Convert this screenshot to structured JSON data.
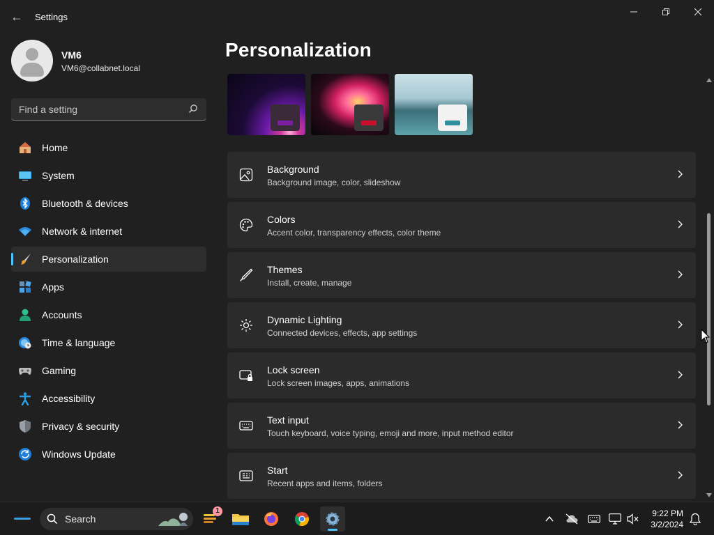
{
  "window": {
    "title": "Settings"
  },
  "user": {
    "name": "VM6",
    "email": "VM6@collabnet.local"
  },
  "search": {
    "placeholder": "Find a setting"
  },
  "sidebar": {
    "items": [
      {
        "label": "Home",
        "icon": "home-icon"
      },
      {
        "label": "System",
        "icon": "system-icon"
      },
      {
        "label": "Bluetooth & devices",
        "icon": "bluetooth-icon"
      },
      {
        "label": "Network & internet",
        "icon": "wifi-icon"
      },
      {
        "label": "Personalization",
        "icon": "brush-icon",
        "active": true
      },
      {
        "label": "Apps",
        "icon": "apps-icon"
      },
      {
        "label": "Accounts",
        "icon": "accounts-icon"
      },
      {
        "label": "Time & language",
        "icon": "globe-clock-icon"
      },
      {
        "label": "Gaming",
        "icon": "gamepad-icon"
      },
      {
        "label": "Accessibility",
        "icon": "accessibility-icon"
      },
      {
        "label": "Privacy & security",
        "icon": "shield-icon"
      },
      {
        "label": "Windows Update",
        "icon": "update-icon"
      }
    ]
  },
  "main": {
    "title": "Personalization",
    "themes": [
      {
        "name": "windows-bloom-dark",
        "accent": "#7a1fa2"
      },
      {
        "name": "glow-flower",
        "accent": "#c8102e"
      },
      {
        "name": "lake",
        "accent": "#2f8f9a"
      }
    ],
    "cards": [
      {
        "title": "Background",
        "subtitle": "Background image, color, slideshow",
        "icon": "image-icon"
      },
      {
        "title": "Colors",
        "subtitle": "Accent color, transparency effects, color theme",
        "icon": "palette-icon"
      },
      {
        "title": "Themes",
        "subtitle": "Install, create, manage",
        "icon": "pen-icon"
      },
      {
        "title": "Dynamic Lighting",
        "subtitle": "Connected devices, effects, app settings",
        "icon": "lighting-icon"
      },
      {
        "title": "Lock screen",
        "subtitle": "Lock screen images, apps, animations",
        "icon": "lock-screen-icon"
      },
      {
        "title": "Text input",
        "subtitle": "Touch keyboard, voice typing, emoji and more, input method editor",
        "icon": "keyboard-icon"
      },
      {
        "title": "Start",
        "subtitle": "Recent apps and items, folders",
        "icon": "start-icon"
      }
    ]
  },
  "taskbar": {
    "search_label": "Search",
    "widget_badge": "1",
    "time": "9:22 PM",
    "date": "3/2/2024"
  },
  "colors": {
    "accent": "#4cc2ff",
    "background": "#202020",
    "card": "#2b2b2b"
  }
}
